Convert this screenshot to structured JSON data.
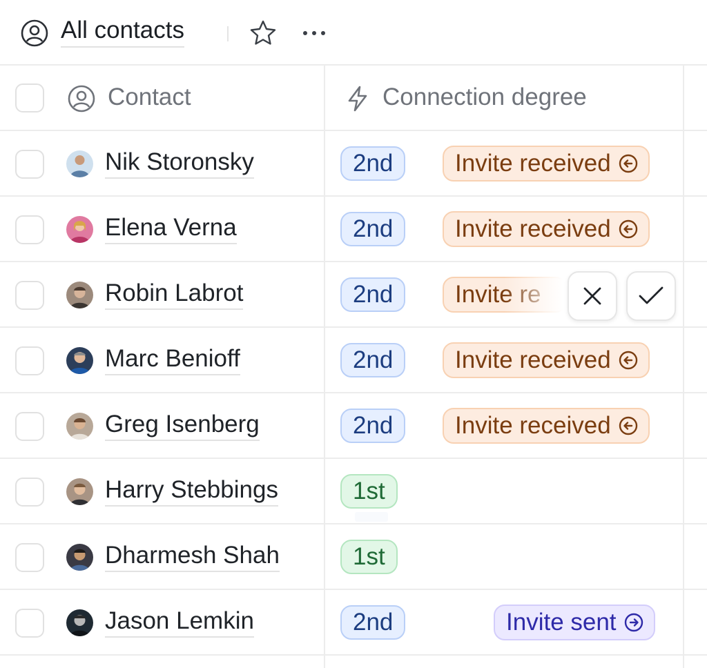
{
  "header": {
    "title": "All contacts",
    "icons": {
      "view": "user-circle-icon",
      "favorite": "star-icon",
      "more": "more-horizontal-icon"
    }
  },
  "table": {
    "columns": [
      {
        "label": "Contact",
        "icon": "user-circle-icon"
      },
      {
        "label": "Connection degree",
        "icon": "lightning-icon"
      }
    ],
    "rows": [
      {
        "name": "Nik Storonsky",
        "degree": "2nd",
        "status": "Invite received",
        "status_type": "received",
        "avatar_color": "#5b7fa6"
      },
      {
        "name": "Elena Verna",
        "degree": "2nd",
        "status": "Invite received",
        "status_type": "received",
        "avatar_color": "#d0527e"
      },
      {
        "name": "Robin Labrot",
        "degree": "2nd",
        "status": "Invite received",
        "status_type": "received",
        "status_visible": "Invite re",
        "avatar_color": "#6f5a4e",
        "hover_actions": [
          "decline",
          "accept"
        ]
      },
      {
        "name": "Marc Benioff",
        "degree": "2nd",
        "status": "Invite received",
        "status_type": "received",
        "avatar_color": "#3a5b86"
      },
      {
        "name": "Greg Isenberg",
        "degree": "2nd",
        "status": "Invite received",
        "status_type": "received",
        "avatar_color": "#8a7460"
      },
      {
        "name": "Harry Stebbings",
        "degree": "1st",
        "status": "",
        "status_type": "none",
        "avatar_color": "#7a6656"
      },
      {
        "name": "Dharmesh Shah",
        "degree": "1st",
        "status": "",
        "status_type": "none",
        "avatar_color": "#4a3c33"
      },
      {
        "name": "Jason Lemkin",
        "degree": "2nd",
        "status": "Invite sent",
        "status_type": "sent",
        "avatar_color": "#2f3a44"
      }
    ]
  },
  "colors": {
    "degree_second_bg": "#e6efff",
    "degree_first_bg": "#e2f7e7",
    "invite_received_bg": "#fdece0",
    "invite_sent_bg": "#ece9ff"
  }
}
